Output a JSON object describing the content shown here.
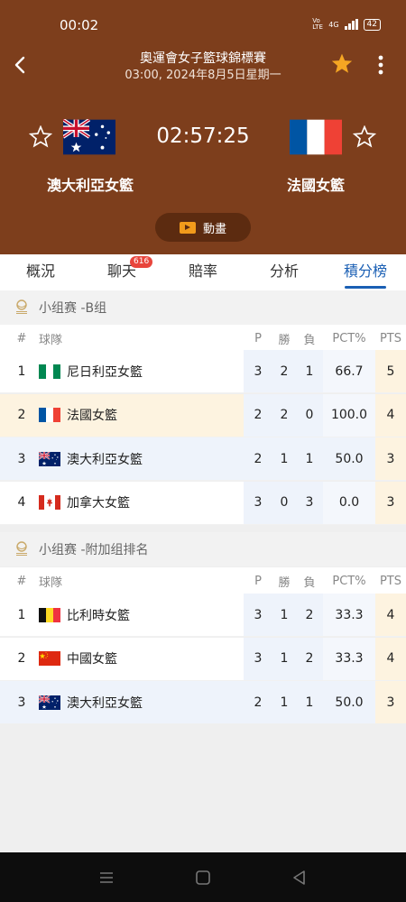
{
  "status_bar": {
    "time": "00:02",
    "network": "4G",
    "volte": "Vo LTE",
    "battery": "42"
  },
  "header": {
    "league": "奧運會女子籃球錦標賽",
    "datetime": "03:00, 2024年8月5日星期一",
    "clock": "02:57:25",
    "home_team": "澳大利亞女籃",
    "away_team": "法國女籃",
    "animation_label": "動畫",
    "accent_color": "#f5a623"
  },
  "tabs": [
    {
      "label": "概況"
    },
    {
      "label": "聊天",
      "badge": "616"
    },
    {
      "label": "賠率"
    },
    {
      "label": "分析"
    },
    {
      "label": "積分榜",
      "active": true
    }
  ],
  "groups": [
    {
      "title": "小组赛 -B组",
      "headers": {
        "rank": "#",
        "team": "球隊",
        "p": "P",
        "w": "勝",
        "l": "負",
        "pct": "PCT%",
        "pts": "PTS"
      },
      "rows": [
        {
          "rank": "1",
          "flag": "nigeria",
          "team": "尼日利亞女籃",
          "p": "3",
          "w": "2",
          "l": "1",
          "pct": "66.7",
          "pts": "5"
        },
        {
          "rank": "2",
          "flag": "france",
          "team": "法國女籃",
          "p": "2",
          "w": "2",
          "l": "0",
          "pct": "100.0",
          "pts": "4"
        },
        {
          "rank": "3",
          "flag": "australia",
          "team": "澳大利亞女籃",
          "p": "2",
          "w": "1",
          "l": "1",
          "pct": "50.0",
          "pts": "3"
        },
        {
          "rank": "4",
          "flag": "canada",
          "team": "加拿大女籃",
          "p": "3",
          "w": "0",
          "l": "3",
          "pct": "0.0",
          "pts": "3"
        }
      ]
    },
    {
      "title": "小组赛 -附加组排名",
      "headers": {
        "rank": "#",
        "team": "球隊",
        "p": "P",
        "w": "勝",
        "l": "負",
        "pct": "PCT%",
        "pts": "PTS"
      },
      "rows": [
        {
          "rank": "1",
          "flag": "belgium",
          "team": "比利時女籃",
          "p": "3",
          "w": "1",
          "l": "2",
          "pct": "33.3",
          "pts": "4"
        },
        {
          "rank": "2",
          "flag": "china",
          "team": "中國女籃",
          "p": "3",
          "w": "1",
          "l": "2",
          "pct": "33.3",
          "pts": "4"
        },
        {
          "rank": "3",
          "flag": "australia",
          "team": "澳大利亞女籃",
          "p": "2",
          "w": "1",
          "l": "1",
          "pct": "50.0",
          "pts": "3"
        }
      ]
    }
  ]
}
